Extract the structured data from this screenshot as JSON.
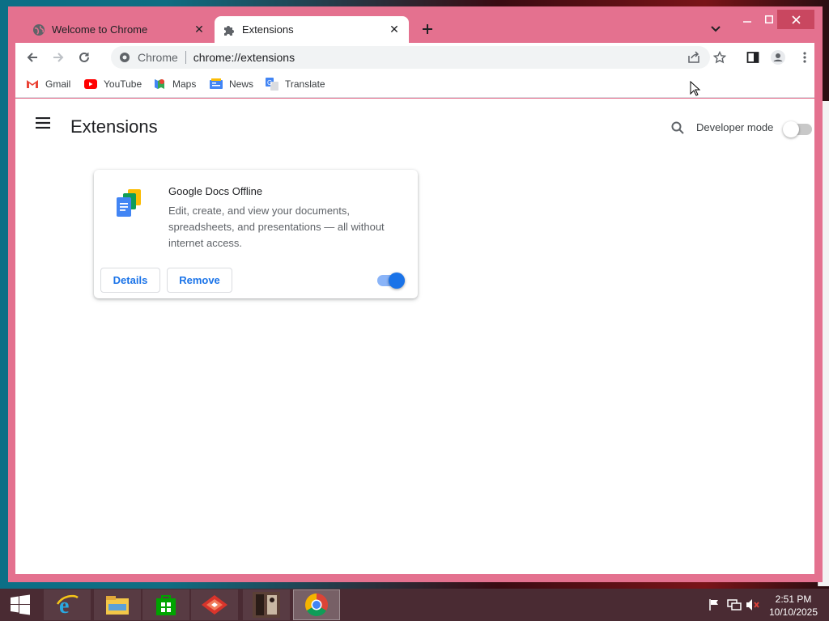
{
  "browser": {
    "tabs": [
      {
        "title": "Welcome to Chrome",
        "icon": "globe-icon",
        "active": false
      },
      {
        "title": "Extensions",
        "icon": "puzzle-icon",
        "active": true
      }
    ],
    "new_tab_label": "+",
    "close_glyph": "✕"
  },
  "toolbar": {
    "omnibox": {
      "chip_label": "Chrome",
      "url": "chrome://extensions"
    }
  },
  "bookmarks": [
    {
      "label": "Gmail",
      "icon": "gmail-icon"
    },
    {
      "label": "YouTube",
      "icon": "youtube-icon"
    },
    {
      "label": "Maps",
      "icon": "maps-icon"
    },
    {
      "label": "News",
      "icon": "news-icon"
    },
    {
      "label": "Translate",
      "icon": "translate-icon"
    }
  ],
  "page": {
    "title": "Extensions",
    "developer_mode_label": "Developer mode",
    "developer_mode_enabled": false
  },
  "extension": {
    "name": "Google Docs Offline",
    "description": "Edit, create, and view your documents, spreadsheets, and presentations — all without internet access.",
    "details_label": "Details",
    "remove_label": "Remove",
    "enabled": true
  },
  "taskbar": {
    "apps": [
      "start-icon",
      "internet-explorer-icon",
      "file-explorer-icon",
      "store-icon",
      "app-red-icon",
      "photo-app-icon",
      "chrome-icon"
    ],
    "clock_time": "2:51 PM",
    "clock_date": "10/10/2025"
  },
  "colors": {
    "window_frame": "#e4718f",
    "accent": "#1a73e8",
    "taskbar": "#4a2b33"
  }
}
